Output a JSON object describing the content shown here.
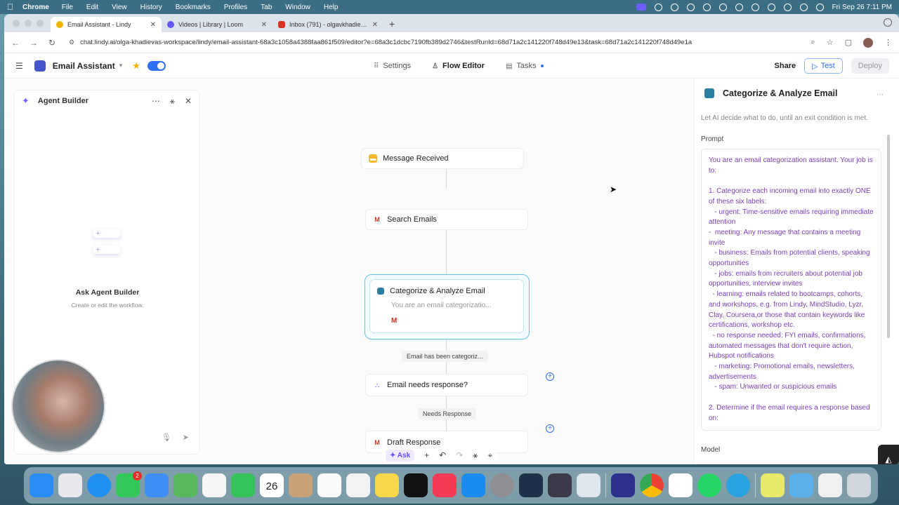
{
  "menubar": {
    "app": "Chrome",
    "items": [
      "File",
      "Edit",
      "View",
      "History",
      "Bookmarks",
      "Profiles",
      "Tab",
      "Window",
      "Help"
    ],
    "datetime": "Fri Sep 26  7:11 PM"
  },
  "browser": {
    "tabs": [
      {
        "title": "Email Assistant - Lindy",
        "active": true
      },
      {
        "title": "Videos | Library | Loom",
        "active": false
      },
      {
        "title": "Inbox (791) - olgavkhadievas",
        "active": false
      }
    ],
    "new_tab": "+",
    "url": "chat.lindy.ai/olga-khadievas-workspace/lindy/email-assistant-68a3c1058a4388faa861f509/editor?e=68a3c1dcbc7190fb389d2746&testRunId=68d71a2c141220f748d49e13&task=68d71a2c141220f748d49e1a"
  },
  "app_header": {
    "agent_name": "Email Assistant",
    "tabs": [
      "Settings",
      "Flow Editor",
      "Tasks"
    ],
    "share": "Share",
    "test": "Test",
    "deploy": "Deploy"
  },
  "agent_builder": {
    "title": "Agent Builder",
    "heading": "Ask Agent Builder",
    "subtitle": "Create or edit the workflow."
  },
  "flow": {
    "nodes": {
      "trigger": "Message Received",
      "search": "Search Emails",
      "categorize_title": "Categorize & Analyze Email",
      "categorize_preview": "You are an email categorizatio...",
      "condition": "Email needs response?",
      "draft": "Draft Response"
    },
    "pills": {
      "exit": "Email has been categoriz...",
      "branch": "Needs Response"
    },
    "toolbar": {
      "ask": "Ask"
    }
  },
  "details": {
    "title": "Categorize & Analyze Email",
    "description": "Let AI decide what to do, until an exit condition is met.",
    "prompt_label": "Prompt",
    "prompt_text": "You are an email categorization assistant. Your job is to:\n\n1. Categorize each incoming email into exactly ONE of these six labels:\n   - urgent: Time-sensitive emails requiring immediate attention\n-  meeting: Any message that contains a meeting invite\n   - business: Emails from potential clients, speaking opportunities\n   - jobs: emails from recruiters about potential job opportunities, interview invites\n  - learning: emails related to bootcamps, cohorts, and workshops, e.g. from Lindy, MindStudio, Lyzr, Clay, Coursera,or those that contain keywords like certifications, workshop etc.\n  - no response needed: FYI emails, confirmations, automated messages that don't require action, Hubspot notifications\n   - marketing: Promotional emails, newsletters, advertisements\n   - spam: Unwanted or suspicious emails\n\n2. Determine if the email requires a response based on:",
    "model_label": "Model"
  },
  "dock": {
    "calendar_day": "26",
    "calendar_month": "FRI",
    "messages_badge": "2"
  }
}
